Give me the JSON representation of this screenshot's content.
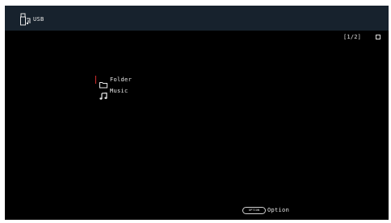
{
  "header": {
    "icon": "usb-icon",
    "title": "USB"
  },
  "status": {
    "page_indicator": "[1/2]",
    "icon": "stop-icon"
  },
  "menu": {
    "items": [
      {
        "icon": "folder-icon",
        "label": "Folder",
        "selected": true
      },
      {
        "icon": "music-note-icon",
        "label": "Music",
        "selected": false
      }
    ]
  },
  "footer": {
    "option_key": "OPTION",
    "option_label": "Option"
  },
  "colors": {
    "header_background": "#17222d",
    "screen_background": "#000000",
    "cursor": "#d22b2b",
    "text": "#e8e8e8"
  }
}
